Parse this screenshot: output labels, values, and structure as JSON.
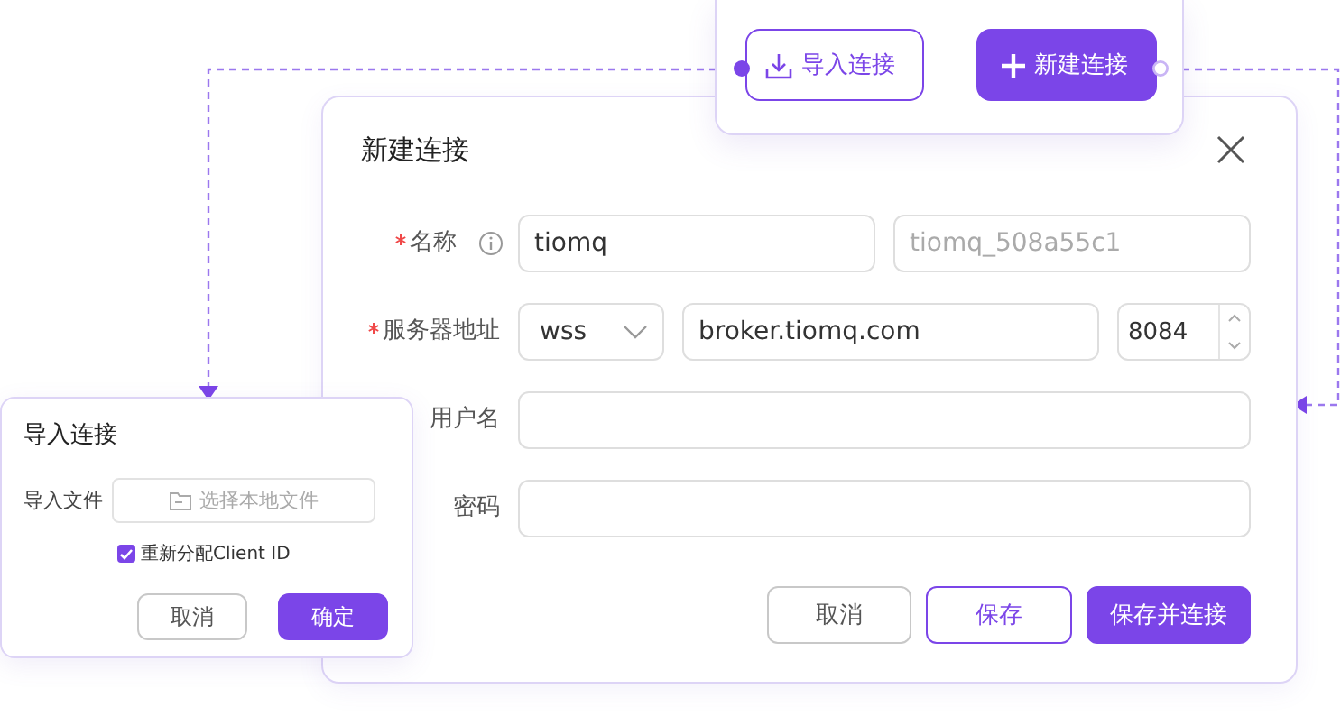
{
  "toolbar": {
    "buttons": [
      {
        "label": "导入连接",
        "kind": "import"
      },
      {
        "label": "新建连接",
        "kind": "create"
      }
    ]
  },
  "dialog": {
    "title": "新建连接",
    "name": {
      "label": "名称",
      "required": true,
      "value": "tiomq",
      "client_id_placeholder": "tiomq_508a55c1"
    },
    "server": {
      "label": "服务器地址",
      "required": true,
      "protocol": "wss",
      "host": "broker.tiomq.com",
      "port": "8084"
    },
    "username": {
      "label": "用户名",
      "required": false
    },
    "password": {
      "label": "密码",
      "required": false
    },
    "buttons": [
      {
        "label": "取消",
        "kind": "plain"
      },
      {
        "label": "保存",
        "kind": "outline"
      },
      {
        "label": "保存并连接",
        "kind": "primary"
      }
    ]
  },
  "import_panel": {
    "title": "导入连接",
    "file_label": "导入文件",
    "file_placeholder": "选择本地文件",
    "reassign": {
      "label": "重新分配Client ID",
      "checked": true
    },
    "buttons": [
      {
        "label": "取消",
        "kind": "plain"
      },
      {
        "label": "确定",
        "kind": "primary"
      }
    ]
  }
}
